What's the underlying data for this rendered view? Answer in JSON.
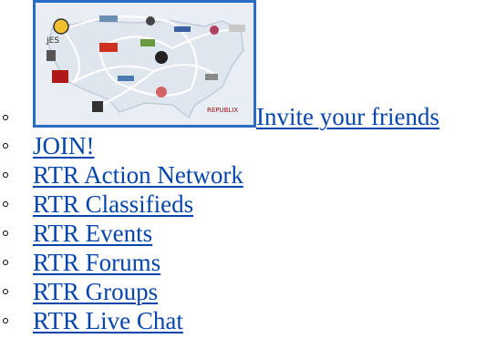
{
  "links": {
    "invite": "Invite your friends",
    "items": [
      "JOIN!",
      "RTR Action Network",
      "RTR Classifieds",
      "RTR Events",
      "RTR Forums",
      "RTR Groups",
      "RTR Live Chat"
    ]
  },
  "map_image": {
    "icon": "us-network-map-image",
    "caption": "REPUBLIX"
  },
  "colors": {
    "link": "#0645ad",
    "image_border": "#2a6cc4"
  }
}
